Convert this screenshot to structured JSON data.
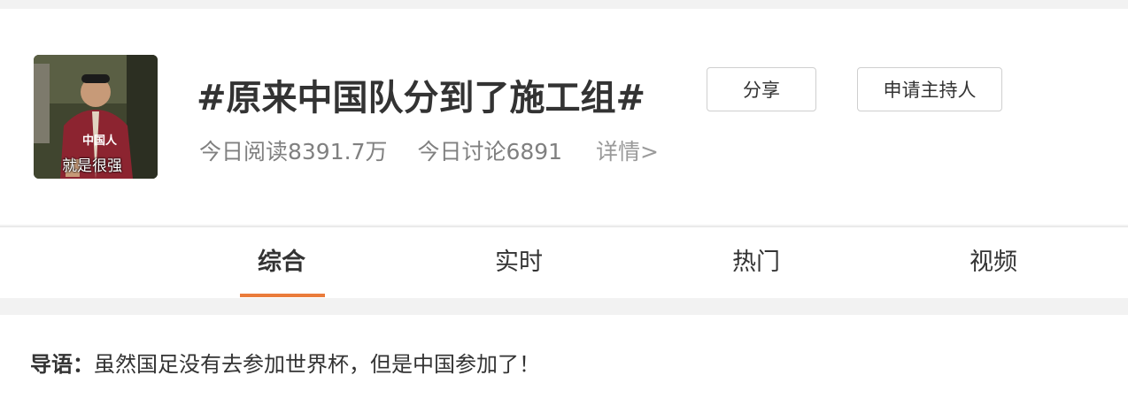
{
  "header": {
    "avatar_caption": "就是很强",
    "avatar_jacket_text": "中国人",
    "title": "#原来中国队分到了施工组#",
    "share_label": "分享",
    "host_label": "申请主持人",
    "stats": {
      "reads": "今日阅读8391.7万",
      "discussions": "今日讨论6891",
      "details": "详情>"
    }
  },
  "tabs": [
    {
      "label": "综合",
      "active": true
    },
    {
      "label": "实时",
      "active": false
    },
    {
      "label": "热门",
      "active": false
    },
    {
      "label": "视频",
      "active": false
    }
  ],
  "lead": {
    "label": "导语：",
    "text": "虽然国足没有去参加世界杯，但是中国参加了！"
  },
  "colors": {
    "accent": "#ea7c3b",
    "text": "#333333",
    "muted": "#808080",
    "background": "#f2f2f2"
  }
}
